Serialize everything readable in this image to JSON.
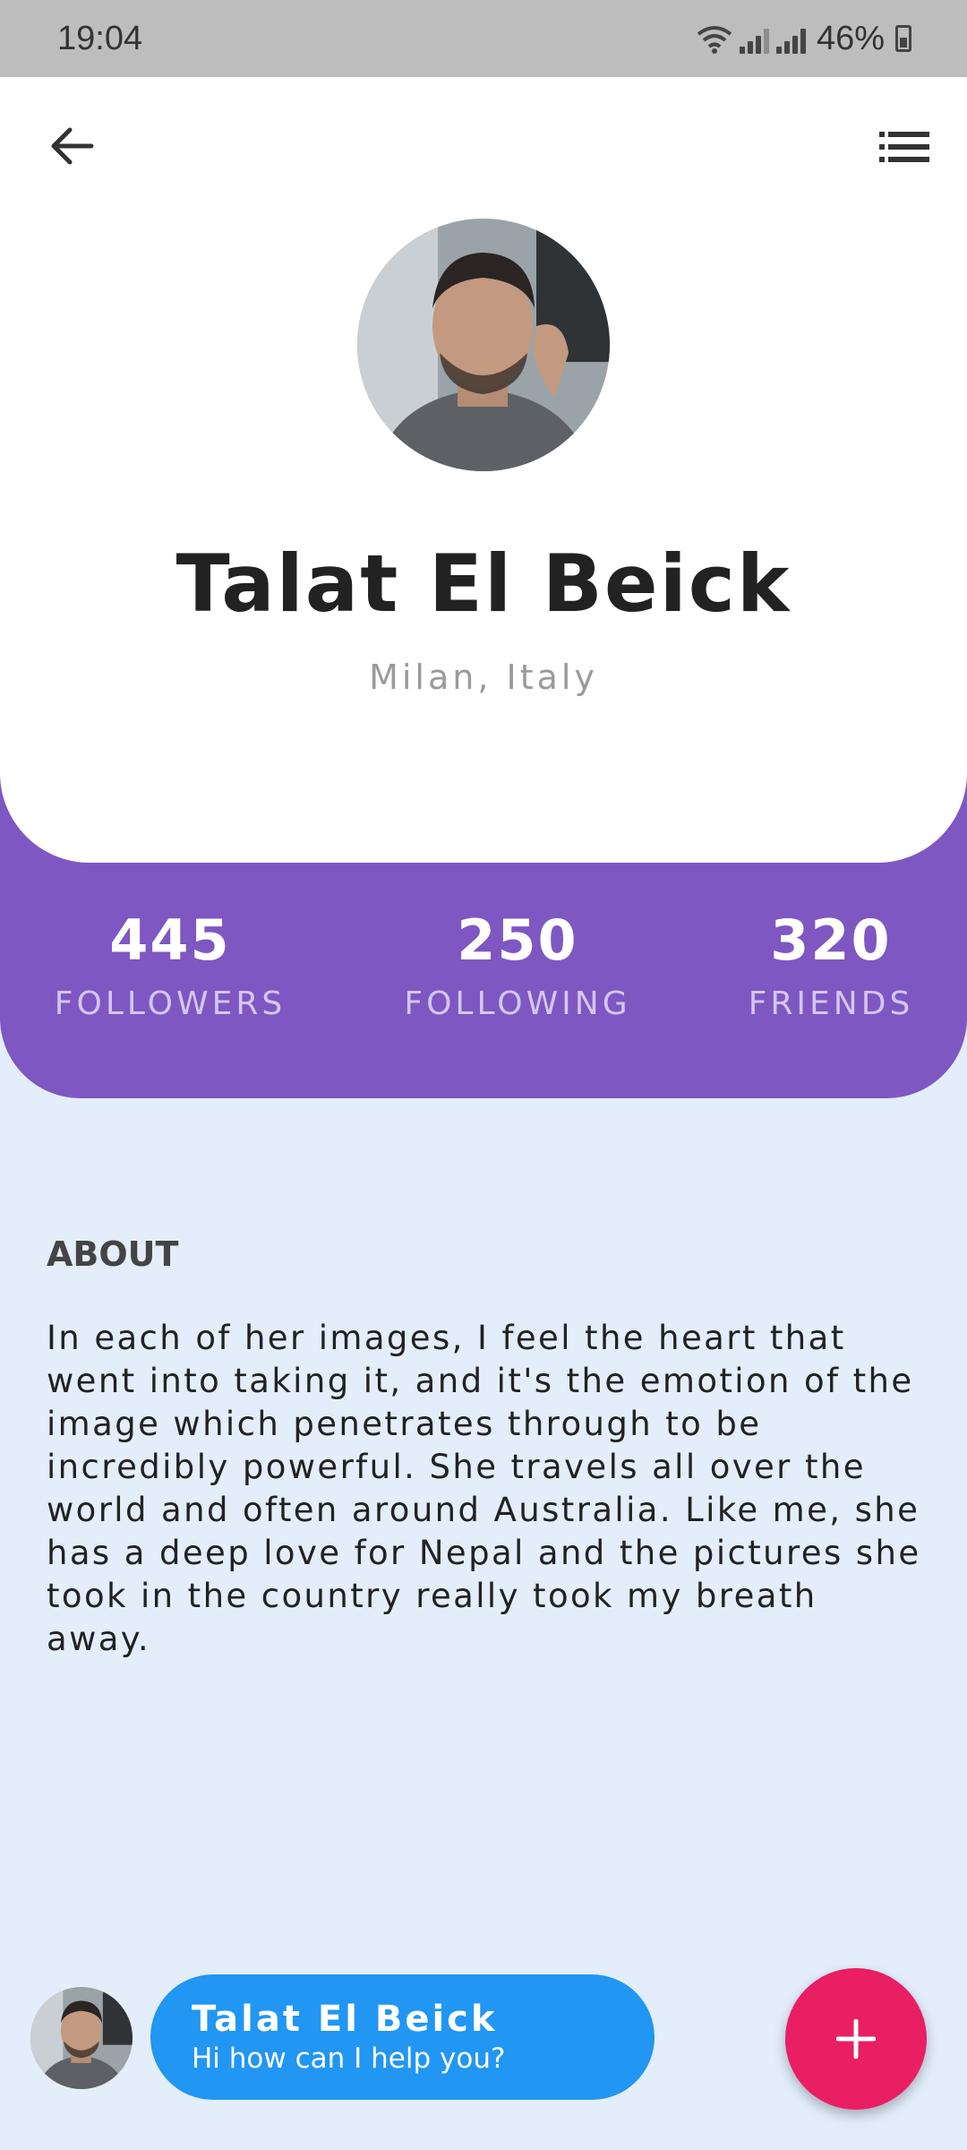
{
  "status_bar": {
    "time": "19:04",
    "battery": "46%",
    "icons": [
      "wifi-icon",
      "signal-icon",
      "signal-icon",
      "battery-icon"
    ]
  },
  "header": {
    "back_icon": "arrow-left-icon",
    "menu_icon": "list-menu-icon"
  },
  "profile": {
    "name": "Talat El Beick",
    "location": "Milan, Italy",
    "avatar": "profile-photo"
  },
  "stats": [
    {
      "value": "445",
      "label": "FOLLOWERS"
    },
    {
      "value": "250",
      "label": "FOLLOWING"
    },
    {
      "value": "320",
      "label": "FRIENDS"
    }
  ],
  "about": {
    "heading": "ABOUT",
    "text": "In each of her images, I feel the heart that went into taking it, and it's the emotion of the image which penetrates through to be incredibly powerful. She travels all over the world and often around Australia. Like me, she has a deep love for Nepal and the pictures she took in the country really took my breath away."
  },
  "chat": {
    "name": "Talat El Beick",
    "message": "Hi how can I help you?"
  },
  "fab": {
    "icon": "plus-icon"
  },
  "colors": {
    "accent_purple": "#7e57c2",
    "chat_blue": "#2196f3",
    "fab_pink": "#e91e63",
    "background": "#e3eefa"
  }
}
